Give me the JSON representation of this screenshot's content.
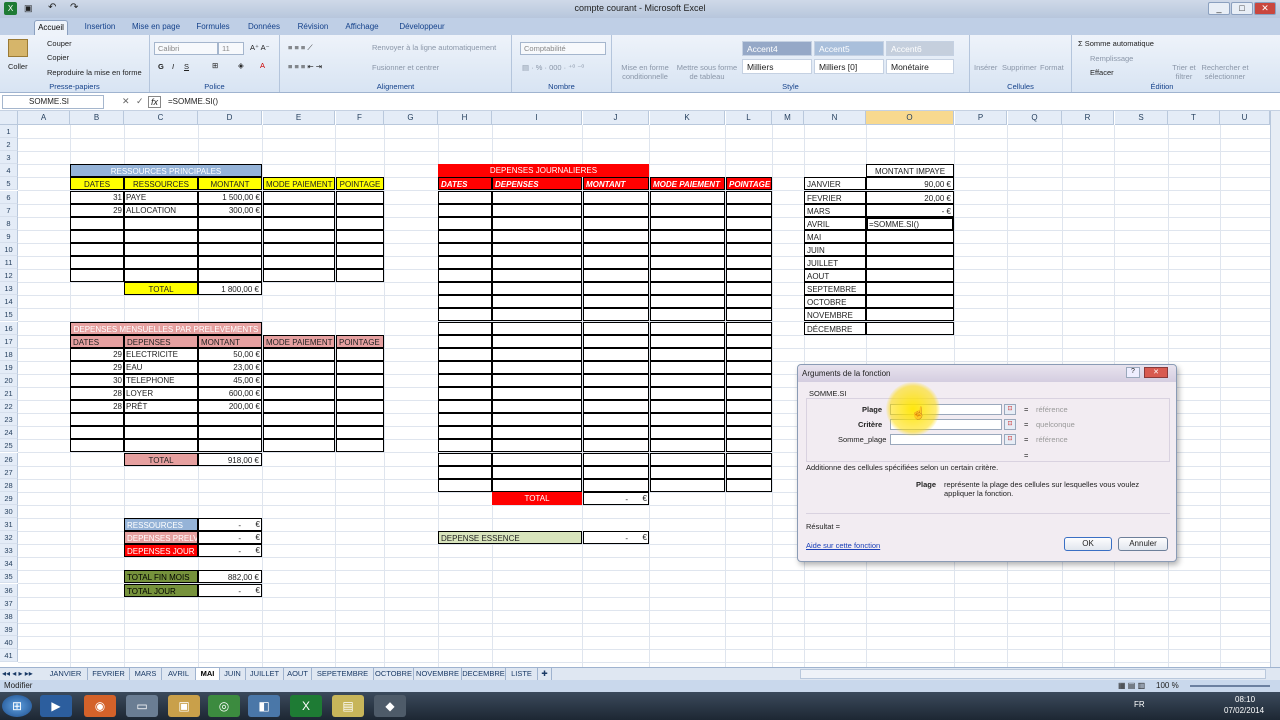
{
  "window": {
    "title": "compte courant - Microsoft Excel"
  },
  "tabs": [
    "Accueil",
    "Insertion",
    "Mise en page",
    "Formules",
    "Données",
    "Révision",
    "Affichage",
    "Développeur"
  ],
  "ribbon": {
    "clipboard": {
      "paste": "Coller",
      "cut": "Couper",
      "copy": "Copier",
      "format_painter": "Reproduire la mise en forme",
      "label": "Presse-papiers"
    },
    "font": {
      "name": "Calibri",
      "size": "11",
      "label": "Police"
    },
    "alignment": {
      "wrap": "Renvoyer à la ligne automatiquement",
      "merge": "Fusionner et centrer",
      "label": "Alignement"
    },
    "number": {
      "format": "Comptabilité",
      "label": "Nombre"
    },
    "style": {
      "conditional": "Mise en forme conditionnelle",
      "table": "Mettre sous forme de tableau",
      "accent4": "Accent4",
      "accent5": "Accent5",
      "accent6": "Accent6",
      "milliers": "Milliers",
      "milliers0": "Milliers [0]",
      "monetaire": "Monétaire",
      "label": "Style"
    },
    "cells": {
      "insert": "Insérer",
      "delete": "Supprimer",
      "format": "Format",
      "label": "Cellules"
    },
    "edit": {
      "autosum": "Σ Somme automatique",
      "fill": "Remplissage",
      "clear": "Effacer",
      "sort": "Trier et filtrer",
      "find": "Rechercher et sélectionner",
      "label": "Édition"
    }
  },
  "formula_bar": {
    "namebox": "SOMME.SI",
    "formula": "=SOMME.SI()"
  },
  "columns": [
    "A",
    "B",
    "C",
    "D",
    "E",
    "F",
    "G",
    "H",
    "I",
    "J",
    "K",
    "L",
    "M",
    "N",
    "O",
    "P",
    "Q",
    "R",
    "S",
    "T",
    "U"
  ],
  "rows": [
    "1",
    "2",
    "3",
    "4",
    "5",
    "6",
    "7",
    "8",
    "9",
    "10",
    "11",
    "12",
    "13",
    "14",
    "15",
    "16",
    "17",
    "18",
    "19",
    "20",
    "21",
    "22",
    "23",
    "24",
    "25",
    "26",
    "27",
    "28",
    "29",
    "30",
    "31",
    "32",
    "33",
    "34",
    "35",
    "36",
    "37",
    "38",
    "39",
    "40",
    "41"
  ],
  "ressources": {
    "title": "RESSOURCES PRINCIPALES",
    "headers": [
      "DATES",
      "RESSOURCES",
      "MONTANT",
      "MODE PAIEMENT",
      "POINTAGE"
    ],
    "rows": [
      [
        "31",
        "PAYE",
        "1 500,00 €"
      ],
      [
        "29",
        "ALLOCATION",
        "300,00 €"
      ]
    ],
    "total_label": "TOTAL",
    "total": "1 800,00 €"
  },
  "mensuelles": {
    "title": "DEPENSES MENSUELLES PAR PRELEVEMENTS",
    "headers": [
      "DATES",
      "DEPENSES",
      "MONTANT",
      "MODE PAIEMENT",
      "POINTAGE"
    ],
    "rows": [
      [
        "29",
        "ELECTRICITE",
        "50,00 €"
      ],
      [
        "29",
        "EAU",
        "23,00 €"
      ],
      [
        "30",
        "TELEPHONE",
        "45,00 €"
      ],
      [
        "28",
        "LOYER",
        "600,00 €"
      ],
      [
        "28",
        "PRÊT",
        "200,00 €"
      ]
    ],
    "total_label": "TOTAL",
    "total": "918,00 €"
  },
  "journalieres": {
    "title": "DEPENSES JOURNALIERES",
    "headers": [
      "DATES",
      "DEPENSES",
      "MONTANT",
      "MODE PAIEMENT",
      "POINTAGE"
    ],
    "total_label": "TOTAL",
    "total": "-",
    "euro": "€"
  },
  "essence": {
    "label": "DEPENSE ESSENCE",
    "value": "-",
    "euro": "€"
  },
  "summary": [
    [
      "RESSOURCES",
      "-",
      "€"
    ],
    [
      "DEPENSES PRELV",
      "-",
      "€"
    ],
    [
      "DEPENSES JOUR",
      "-",
      "€"
    ],
    [
      "TOTAL FIN MOIS",
      "882,00 €",
      ""
    ],
    [
      "TOTAL JOUR",
      "-",
      "€"
    ]
  ],
  "impaye": {
    "header": "MONTANT IMPAYE",
    "months": [
      "JANVIER",
      "FEVRIER",
      "MARS",
      "AVRIL",
      "MAI",
      "JUIN",
      "JUILLET",
      "AOUT",
      "SEPTEMBRE",
      "OCTOBRE",
      "NOVEMBRE",
      "DÉCEMBRE"
    ],
    "values": [
      "90,00 €",
      "20,00 €",
      "-   €",
      "=SOMME.SI()",
      "",
      "",
      "",
      "",
      "",
      "",
      "",
      ""
    ]
  },
  "dialog": {
    "title": "Arguments de la fonction",
    "func": "SOMME.SI",
    "args": [
      {
        "name": "Plage",
        "hint": "référence"
      },
      {
        "name": "Critère",
        "hint": "quelconque"
      },
      {
        "name": "Somme_plage",
        "hint": "référence"
      }
    ],
    "eq": "=",
    "dash": "=",
    "desc": "Additionne des cellules spécifiées selon un certain critère.",
    "arg_name": "Plage",
    "arg_desc": "représente la plage des cellules sur lesquelles vous voulez appliquer la fonction.",
    "result": "Résultat =",
    "help": "Aide sur cette fonction",
    "ok": "OK",
    "cancel": "Annuler"
  },
  "sheets": [
    "JANVIER",
    "FEVRIER",
    "MARS",
    "AVRIL",
    "MAI",
    "JUIN",
    "JUILLET",
    "AOUT",
    "SEPETEMBRE",
    "OCTOBRE",
    "NOVEMBRE",
    "DECEMBRE",
    "LISTE"
  ],
  "active_sheet": "MAI",
  "status": {
    "mode": "Modifier",
    "zoom": "100 %"
  },
  "taskbar": {
    "lang": "FR",
    "time": "08:10",
    "date": "07/02/2014"
  }
}
